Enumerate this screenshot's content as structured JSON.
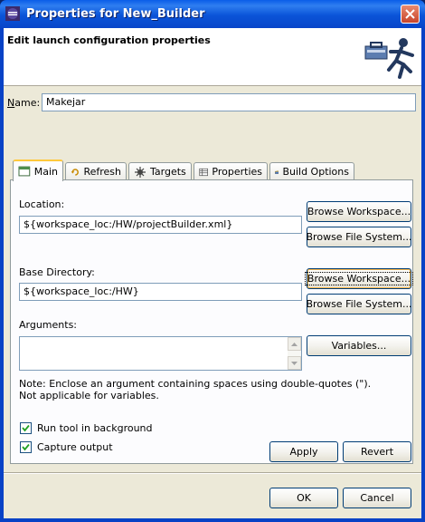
{
  "window": {
    "title": "Properties for New_Builder"
  },
  "header": {
    "title": "Edit launch configuration properties"
  },
  "name": {
    "label": "Name:",
    "value": "Makejar"
  },
  "tabs": [
    {
      "label": "Main",
      "icon": "main-tab-icon",
      "active": true
    },
    {
      "label": "Refresh",
      "icon": "refresh-icon",
      "active": false
    },
    {
      "label": "Targets",
      "icon": "targets-icon",
      "active": false
    },
    {
      "label": "Properties",
      "icon": "properties-icon",
      "active": false
    },
    {
      "label": "Build Options",
      "icon": "folder-icon",
      "active": false
    }
  ],
  "main": {
    "location": {
      "label": "Location:",
      "value": "${workspace_loc:/HW/projectBuilder.xml}",
      "browse_workspace": "Browse Workspace...",
      "browse_filesystem": "Browse File System..."
    },
    "base_directory": {
      "label": "Base Directory:",
      "value": "${workspace_loc:/HW}",
      "browse_workspace": "Browse Workspace...",
      "browse_filesystem": "Browse File System..."
    },
    "arguments": {
      "label": "Arguments:",
      "value": "",
      "variables_button": "Variables..."
    },
    "note_line1": "Note: Enclose an argument containing spaces using double-quotes (\").",
    "note_line2": "Not applicable for variables.",
    "run_background": {
      "label": "Run tool in background",
      "checked": true
    },
    "capture_output": {
      "label": "Capture output",
      "checked": true
    }
  },
  "buttons": {
    "apply": "Apply",
    "revert": "Revert",
    "ok": "OK",
    "cancel": "Cancel"
  },
  "colors": {
    "titlebar": "#0a54d8",
    "dialog_bg": "#ece9d8",
    "active_tab_accent": "#ffc83c"
  }
}
